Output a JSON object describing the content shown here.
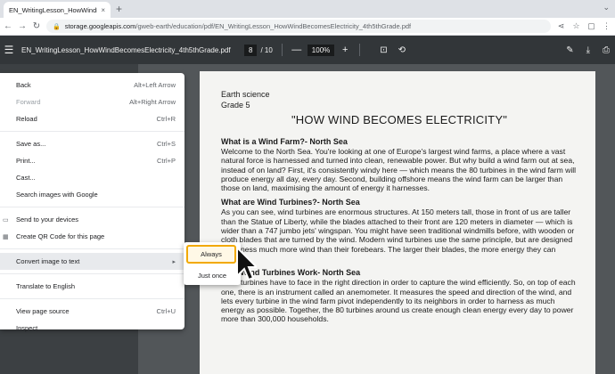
{
  "browser": {
    "tab_title": "EN_WritingLesson_HowWindBe...",
    "tab_close": "×",
    "new_tab": "+",
    "window_controls": "⌄",
    "url_host": "storage.googleapis.com",
    "url_path": "/gweb-earth/education/pdf/EN_WritingLesson_HowWindBecomesElectricity_4th5thGrade.pdf",
    "nav_back": "←",
    "nav_forward": "→",
    "nav_reload": "↻",
    "lock_icon": "🔒",
    "share_icon": "⋖",
    "star_icon": "☆",
    "ext_icon": "▢",
    "menu_icon": "⋮"
  },
  "pdf_toolbar": {
    "menu_icon": "☰",
    "title": "EN_WritingLesson_HowWindBecomesElectricity_4th5thGrade.pdf",
    "page_current": "8",
    "page_total": "/ 10",
    "zoom_out": "—",
    "zoom_level": "100%",
    "zoom_in": "+",
    "fit_icon": "⊡",
    "rotate_icon": "⟲",
    "edit_icon": "✎",
    "download_icon": "⤓",
    "print_icon": "⎙"
  },
  "page": {
    "subject": "Earth science",
    "grade": "Grade 5",
    "heading": "\"HOW WIND BECOMES ELECTRICITY\"",
    "sections": [
      {
        "title": "What is a Wind Farm?- North Sea",
        "body": "Welcome to the North Sea. You're looking at one of Europe's largest wind farms, a place where a vast natural force is harnessed and turned into clean, renewable power. But why build a wind farm out at sea, instead of on land? First, it's consistently windy here — which means the 80 turbines in the wind farm will produce energy all day, every day. Second, building offshore means the wind farm can be larger than those on land, maximising the amount of energy it harnesses."
      },
      {
        "title": "What are Wind Turbines?- North Sea",
        "body": "As you can see, wind turbines are enormous structures. At 150 meters tall, those in front of us are taller than the Statue of Liberty, while the blades attached to their front are 120 meters in diameter — which is wider than a 747 jumbo jets' wingspan. You might have seen traditional windmills before, with wooden or cloth blades that are turned by the wind. Modern wind turbines use the same principle, but are designed to harness much more wind than their forebears. The larger their blades, the more energy they can create."
      },
      {
        "title": "How Wind Turbines Work- North Sea",
        "body": "Wind turbines have to face in the right direction in order to capture the wind efficiently. So, on top of each one, there is an instrument called an anemometer. It measures the speed and direction of the wind, and lets every turbine in the wind farm pivot independently to its neighbors in order to harness as much energy as possible. Together, the 80 turbines around us create enough clean energy every day to power more than 300,000 households."
      }
    ]
  },
  "context_menu": {
    "back": "Back",
    "back_sc": "Alt+Left Arrow",
    "forward": "Forward",
    "forward_sc": "Alt+Right Arrow",
    "reload": "Reload",
    "reload_sc": "Ctrl+R",
    "save_as": "Save as...",
    "save_as_sc": "Ctrl+S",
    "print": "Print...",
    "print_sc": "Ctrl+P",
    "cast": "Cast...",
    "search_images": "Search images with Google",
    "send_to_devices": "Send to your devices",
    "create_qr": "Create QR Code for this page",
    "convert_image": "Convert image to text",
    "convert_arrow": "▸",
    "translate": "Translate to English",
    "view_source": "View page source",
    "view_source_sc": "Ctrl+U",
    "inspect": "Inspect",
    "device_icon": "▭",
    "qr_icon": "▦"
  },
  "submenu": {
    "always": "Always",
    "just_once": "Just once"
  },
  "colors": {
    "highlight": "#f2a900",
    "pdf_toolbar": "#323639",
    "viewer_bg": "#525659"
  }
}
